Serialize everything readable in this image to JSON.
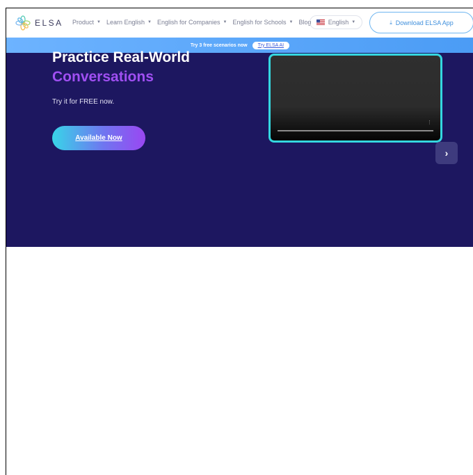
{
  "brand": {
    "name": "ELSA",
    "logo_icon": "elsa-flower-logo"
  },
  "nav": {
    "items": [
      {
        "label": "Product",
        "has_caret": true
      },
      {
        "label": "Learn English",
        "has_caret": true
      },
      {
        "label": "English for Companies",
        "has_caret": true
      },
      {
        "label": "English for Schools",
        "has_caret": true
      },
      {
        "label": "Blog",
        "has_caret": false
      }
    ],
    "language": {
      "label": "English",
      "flag": "us-flag-icon"
    },
    "download_label": "Download ELSA App"
  },
  "promo": {
    "text": "Try 3 free scenarios now",
    "button_label": "Try ELSA AI"
  },
  "hero": {
    "title_line1": "Practice Real-World",
    "title_line2": "Conversations",
    "subtitle": "Try it for FREE now.",
    "cta_label": "Available Now",
    "next_icon": "chevron-right-icon"
  },
  "colors": {
    "hero_bg": "#1d1760",
    "accent_purple": "#a04ff2",
    "video_border": "#34d7e0",
    "promo_bg": "#4b9cf5"
  }
}
